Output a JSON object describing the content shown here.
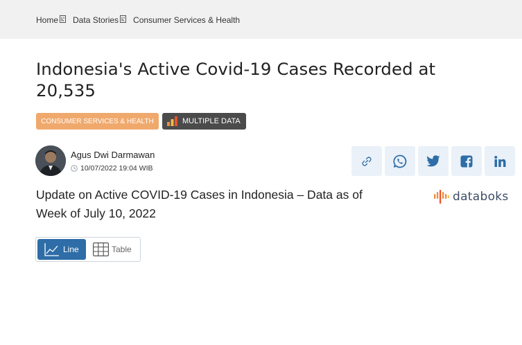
{
  "breadcrumb": {
    "home": "Home",
    "data_stories": "Data Stories",
    "current": "Consumer Services & Health"
  },
  "article": {
    "title": "Indonesia's Active Covid-19 Cases Recorded at 20,535",
    "category_tag": "CONSUMER SERVICES & HEALTH",
    "multiple_data_tag": "MULTIPLE DATA",
    "author": "Agus Dwi Darmawan",
    "date": "10/07/2022 19:04 WIB",
    "chart_subtitle": "Update on Active COVID-19 Cases in Indonesia – Data as of Week of July 10, 2022"
  },
  "share_buttons": [
    {
      "icon": "link-icon"
    },
    {
      "icon": "whatsapp-icon"
    },
    {
      "icon": "twitter-icon"
    },
    {
      "icon": "facebook-icon"
    },
    {
      "icon": "linkedin-icon"
    }
  ],
  "brand": {
    "logo_text": "databoks"
  },
  "view_toggle": {
    "line_label": "Line",
    "table_label": "Table",
    "active": "Line"
  },
  "colors": {
    "accent_blue": "#2e6da7",
    "category_tag_bg": "#f0a96d",
    "multiple_tag_bg": "#4b4b4b",
    "share_bg": "#eaf1f8",
    "share_icon": "#2e6da7",
    "logo_orange": "#f08c3c"
  }
}
